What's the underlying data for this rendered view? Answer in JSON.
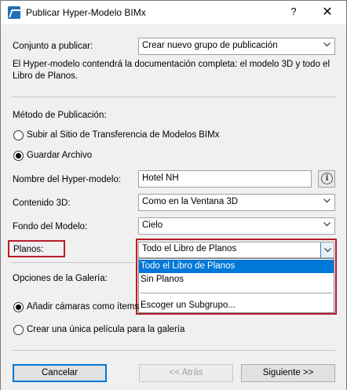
{
  "window": {
    "title": "Publicar Hyper-Modelo BIMx",
    "help_label": "?",
    "close_label": "✕"
  },
  "publish_set": {
    "label": "Conjunto a publicar:",
    "value": "Crear nuevo grupo de publicación",
    "description": "El Hyper-modelo contendrá la documentación completa: el modelo 3D y todo el Libro de Planos."
  },
  "method": {
    "heading": "Método de Publicación:",
    "options": [
      {
        "label": "Subir al Sitio de Transferencia de Modelos BIMx",
        "checked": false
      },
      {
        "label": "Guardar Archivo",
        "checked": true
      }
    ]
  },
  "fields": {
    "name_label": "Nombre del Hyper-modelo:",
    "name_value": "Hotel NH",
    "content3d_label": "Contenido 3D:",
    "content3d_value": "Como en la Ventana 3D",
    "background_label": "Fondo del Modelo:",
    "background_value": "Cielo",
    "plans_label": "Planos:",
    "plans_value": "Todo el Libro de Planos"
  },
  "plans_dropdown": {
    "items": [
      {
        "label": "Todo el Libro de Planos",
        "selected": true
      },
      {
        "label": "Sin Planos",
        "selected": false
      },
      {
        "label": "Escoger un Subgrupo...",
        "selected": false
      }
    ]
  },
  "gallery": {
    "heading": "Opciones de la Galería:",
    "options": [
      {
        "label": "Añadir cámaras como ítems",
        "checked": true
      },
      {
        "label": "Crear una única película para la galería",
        "checked": false
      }
    ]
  },
  "footer": {
    "cancel_label": "Cancelar",
    "back_label": "<< Atrás",
    "next_label": "Siguiente >>"
  },
  "colors": {
    "highlight": "#b81c2a",
    "selection": "#0078d7"
  }
}
